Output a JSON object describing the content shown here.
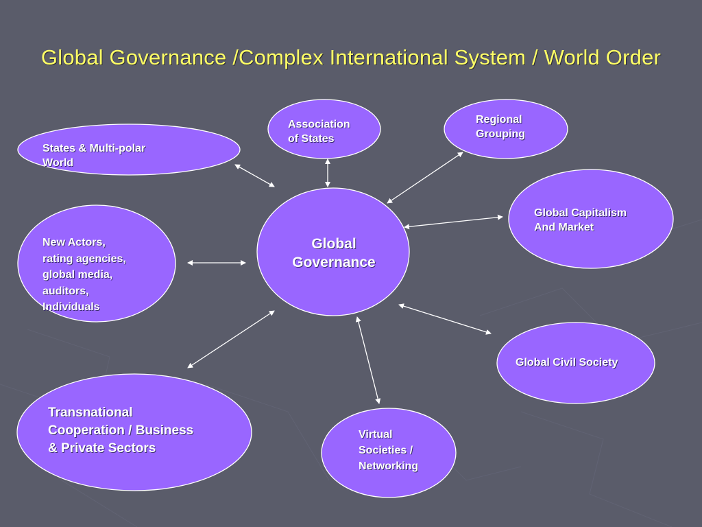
{
  "slide": {
    "title": "Global Governance /Complex International System / World Order"
  },
  "colors": {
    "background": "#5a5c6a",
    "node_fill": "#9966ff",
    "node_stroke": "#ffffff",
    "title_color": "#ffff66",
    "arrow_color": "#ffffff"
  },
  "diagram": {
    "center": {
      "label": "Global\nGovernance"
    },
    "nodes": [
      {
        "id": "states-multipolar",
        "label": "States & Multi-polar\nWorld"
      },
      {
        "id": "association-states",
        "label": "Association\nof States"
      },
      {
        "id": "regional-grouping",
        "label": "Regional\nGrouping"
      },
      {
        "id": "global-capitalism",
        "label": "Global Capitalism\nAnd Market"
      },
      {
        "id": "new-actors",
        "label": "New Actors,\nrating agencies,\nglobal media,\nauditors,\nIndividuals"
      },
      {
        "id": "global-civil-society",
        "label": "Global Civil Society"
      },
      {
        "id": "transnational",
        "label": "Transnational\nCooperation / Business\n& Private Sectors"
      },
      {
        "id": "virtual-societies",
        "label": "Virtual\nSocieties /\nNetworking"
      }
    ]
  }
}
